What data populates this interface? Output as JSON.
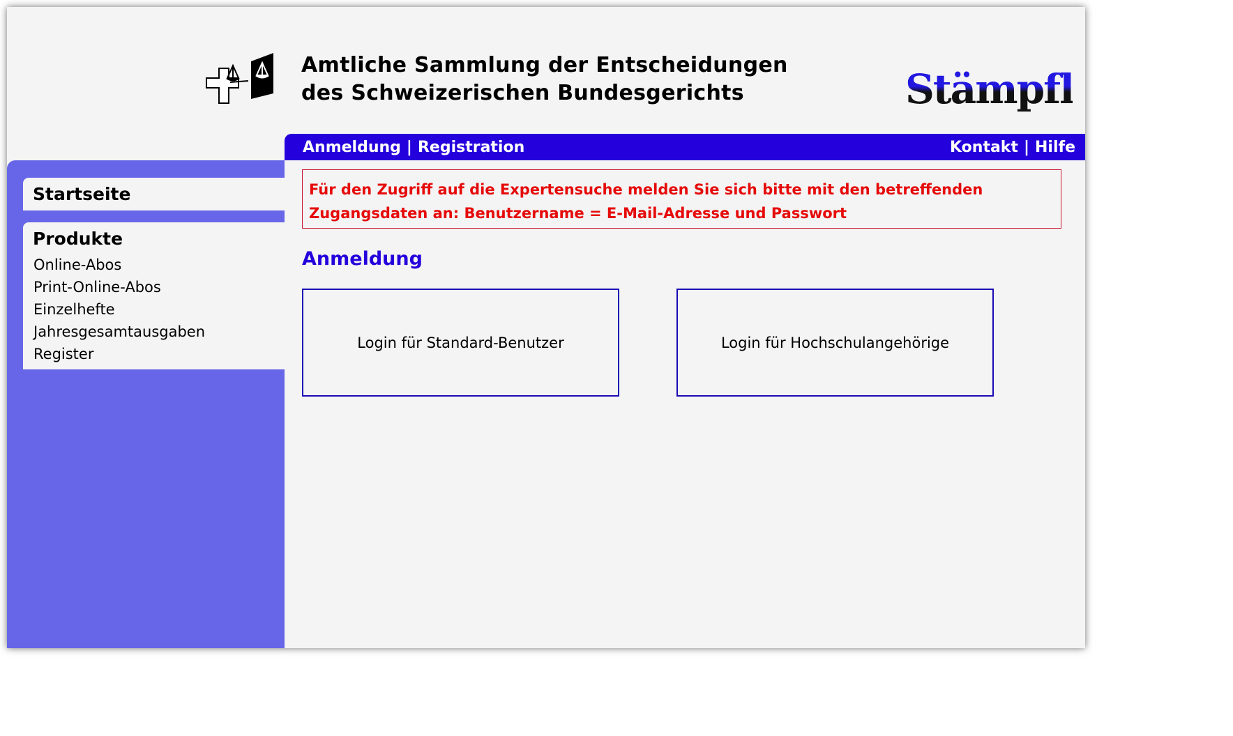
{
  "header": {
    "title_line1": "Amtliche Sammlung der Entscheidungen",
    "title_line2": "des Schweizerischen Bundesgerichts",
    "emblem_icon": "swiss-cross-scales-icon",
    "publisher_logo": "Stämpfli"
  },
  "topnav": {
    "login": "Anmeldung",
    "register": "Registration",
    "contact": "Kontakt",
    "help": "Hilfe",
    "separator": "|"
  },
  "sidebar": {
    "home": "Startseite",
    "products_heading": "Produkte",
    "products": [
      "Online-Abos",
      "Print-Online-Abos",
      "Einzelhefte",
      "Jahresgesamtausgaben",
      "Register"
    ]
  },
  "main": {
    "notice": "Für den Zugriff auf die Expertensuche melden Sie sich bitte mit den betreffenden Zugangsdaten an: Benutzername = E-Mail-Adresse und Passwort",
    "heading": "Anmeldung",
    "login_standard": "Login für Standard-Benutzer",
    "login_university": "Login für Hochschulangehörige"
  },
  "colors": {
    "nav_blue": "#2300dc",
    "sidebar_blue": "#6766e8",
    "notice_red": "#e60a0a",
    "background": "#f4f4f4"
  }
}
